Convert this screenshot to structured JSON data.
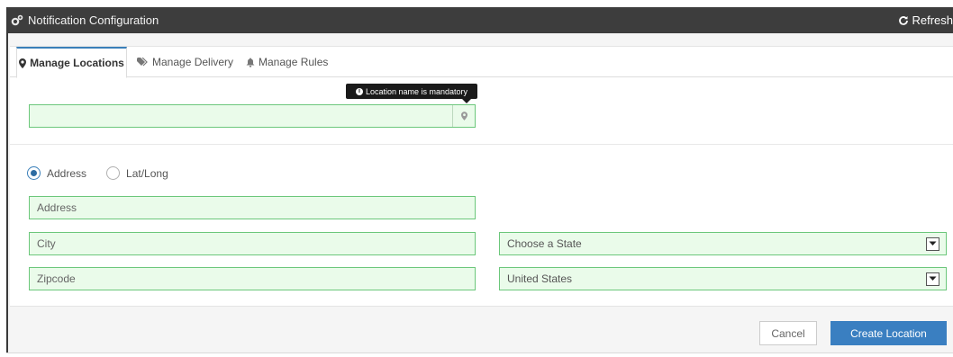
{
  "header": {
    "title": "Notification Configuration",
    "refresh_label": "Refresh",
    "title_icon": "cogs-icon",
    "refresh_icon": "refresh-icon"
  },
  "tabs": [
    {
      "label": "Manage Locations",
      "icon": "map-marker-icon",
      "active": true
    },
    {
      "label": "Manage Delivery",
      "icon": "tags-icon",
      "active": false
    },
    {
      "label": "Manage Rules",
      "icon": "bell-icon",
      "active": false
    }
  ],
  "location_name": {
    "value": "",
    "tooltip": "Location name is mandatory",
    "addon_icon": "map-marker-icon"
  },
  "mode": {
    "options": [
      "Address",
      "Lat/Long"
    ],
    "selected": "Address"
  },
  "form": {
    "address_placeholder": "Address",
    "city_placeholder": "City",
    "zipcode_placeholder": "Zipcode",
    "state_value": "Choose a State",
    "country_value": "United States"
  },
  "footer": {
    "cancel_label": "Cancel",
    "create_label": "Create Location"
  },
  "colors": {
    "titlebar": "#3d3d3d",
    "valid_border": "#6cc77b",
    "valid_fill": "#eafbea",
    "primary": "#3a7fc1"
  }
}
